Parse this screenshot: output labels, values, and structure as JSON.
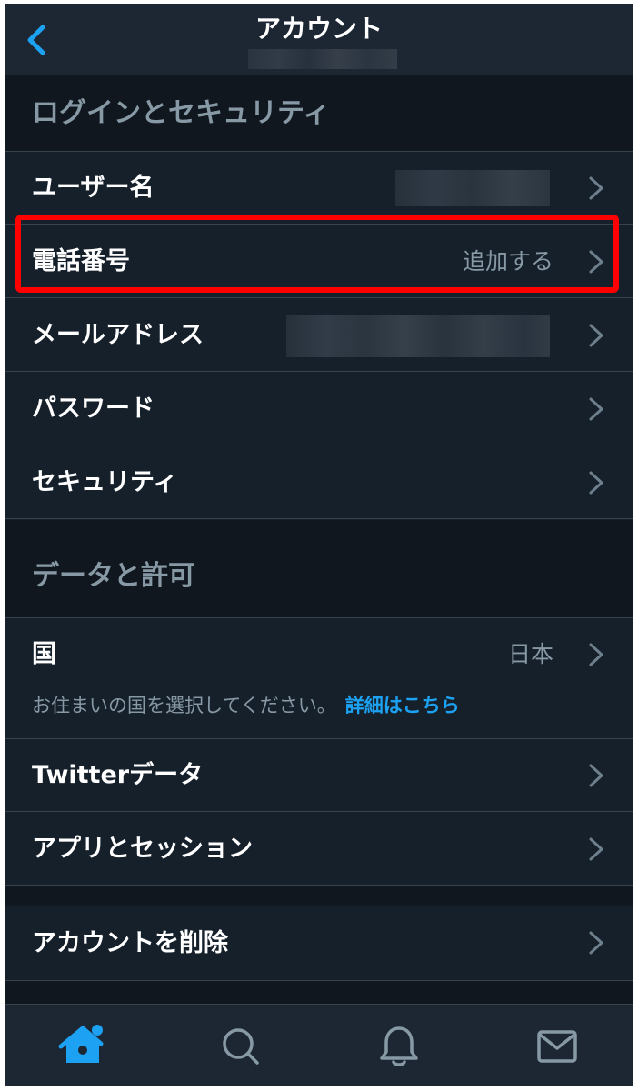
{
  "header": {
    "title": "アカウント",
    "back_icon": "chevron-left-icon"
  },
  "sections": {
    "login_security": {
      "title": "ログインとセキュリティ",
      "items": [
        {
          "label": "ユーザー名",
          "value": ""
        },
        {
          "label": "電話番号",
          "value": "追加する"
        },
        {
          "label": "メールアドレス",
          "value": ""
        },
        {
          "label": "パスワード",
          "value": ""
        },
        {
          "label": "セキュリティ",
          "value": ""
        }
      ]
    },
    "data_permissions": {
      "title": "データと許可",
      "country": {
        "label": "国",
        "value": "日本",
        "description": "お住まいの国を選択してください。",
        "link": "詳細はこちら"
      },
      "items": [
        {
          "label": "Twitterデータ"
        },
        {
          "label": "アプリとセッション"
        }
      ]
    },
    "delete": {
      "label": "アカウントを削除"
    }
  },
  "tabbar": {
    "items": [
      {
        "icon": "home-icon",
        "active": true
      },
      {
        "icon": "search-icon",
        "active": false
      },
      {
        "icon": "bell-icon",
        "active": false
      },
      {
        "icon": "mail-icon",
        "active": false
      }
    ]
  },
  "colors": {
    "background": "#15202b",
    "section_bg": "#10171e",
    "accent": "#1da1f2",
    "highlight": "#ff0000",
    "text_secondary": "#8899a6"
  }
}
